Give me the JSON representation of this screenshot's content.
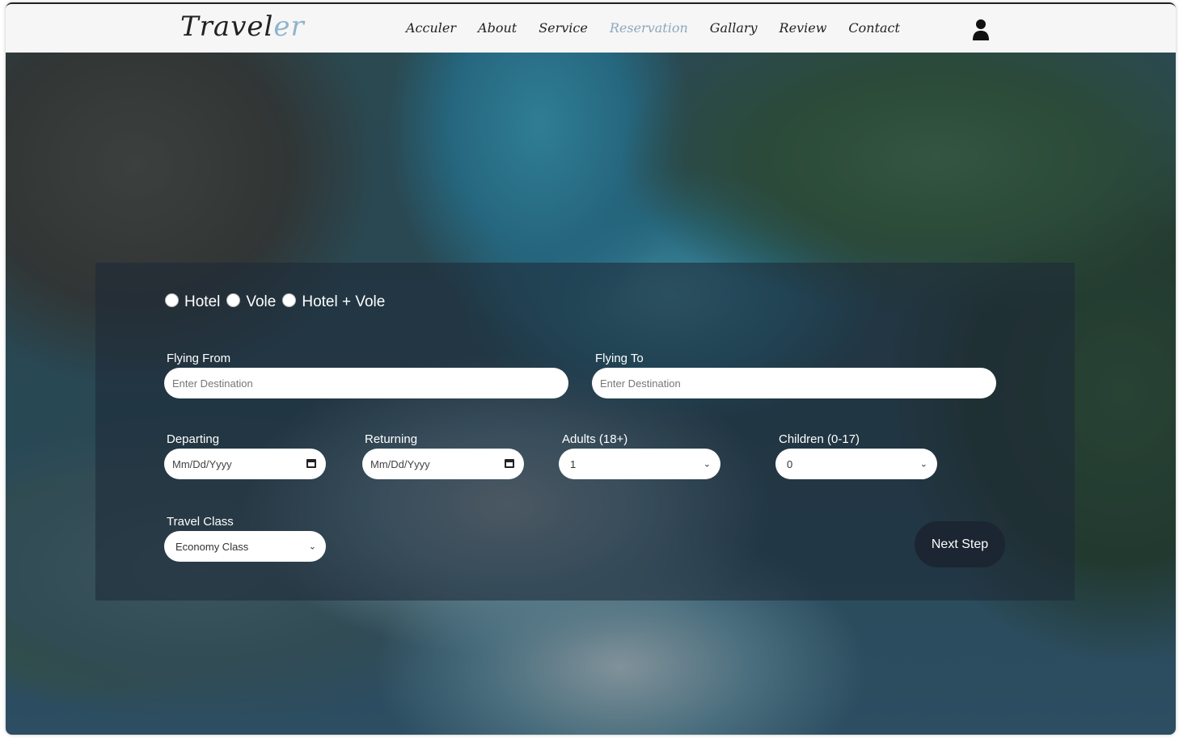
{
  "brand": {
    "name_main": "Travel",
    "name_accent": "er"
  },
  "nav": {
    "items": [
      {
        "label": "Acculer"
      },
      {
        "label": "About"
      },
      {
        "label": "Service"
      },
      {
        "label": "Reservation",
        "active": true
      },
      {
        "label": "Gallary"
      },
      {
        "label": "Review"
      },
      {
        "label": "Contact"
      }
    ],
    "user_icon": "user-icon"
  },
  "form": {
    "trip_types": [
      "Hotel",
      "Vole",
      "Hotel + Vole"
    ],
    "flying_from": {
      "label": "Flying From",
      "placeholder": "Enter Destination"
    },
    "flying_to": {
      "label": "Flying To",
      "placeholder": "Enter Destination"
    },
    "departing": {
      "label": "Departing",
      "value": "Mm/Dd/Yyyy"
    },
    "returning": {
      "label": "Returning",
      "value": "Mm/Dd/Yyyy"
    },
    "adults": {
      "label": "Adults (18+)",
      "value": "1"
    },
    "children": {
      "label": "Children (0-17)",
      "value": "0"
    },
    "travel_class": {
      "label": "Travel Class",
      "value": "Economy Class"
    },
    "next_button": "Next Step"
  },
  "colors": {
    "brand_accent": "#8fb3cc",
    "nav_active": "#8fa7be",
    "button_bg": "#1b2632"
  }
}
